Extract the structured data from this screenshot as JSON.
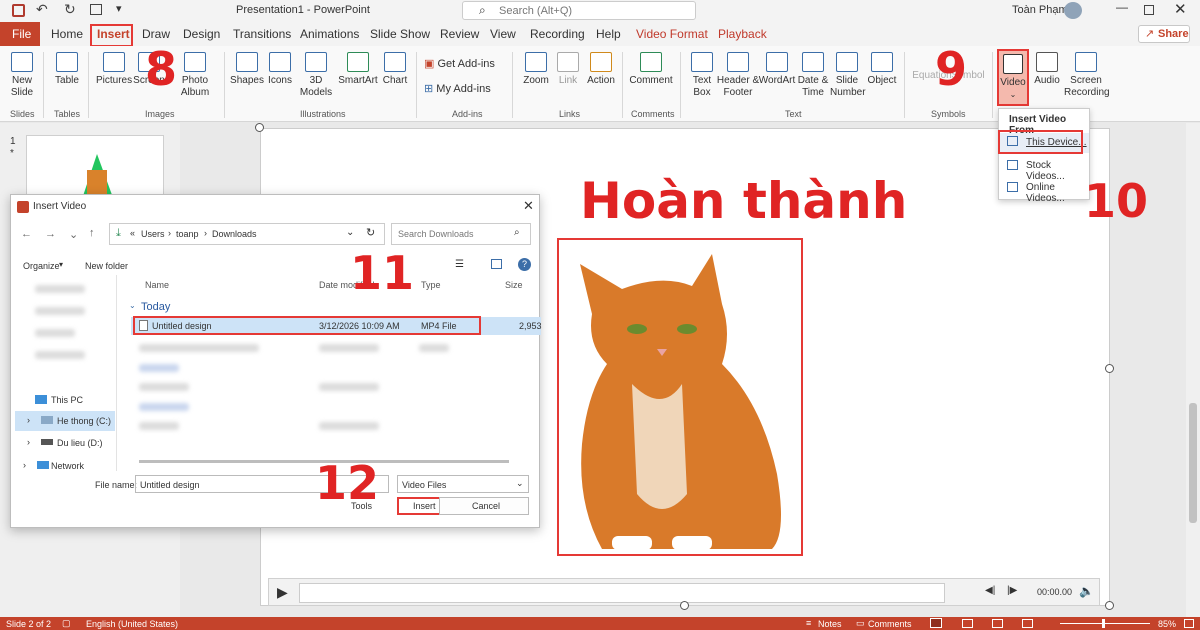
{
  "titlebar": {
    "doc_title": "Presentation1  -  PowerPoint",
    "search_placeholder": "Search (Alt+Q)",
    "user_name": "Toàn Phạm"
  },
  "tabs": {
    "file": "File",
    "home": "Home",
    "insert": "Insert",
    "draw": "Draw",
    "design": "Design",
    "transitions": "Transitions",
    "animations": "Animations",
    "slideshow": "Slide Show",
    "review": "Review",
    "view": "View",
    "recording": "Recording",
    "help": "Help",
    "videoformat": "Video Format",
    "playback": "Playback",
    "share": "Share"
  },
  "ribbon": {
    "new_slide": "New Slide",
    "table": "Table",
    "pictures": "Pictures",
    "screenshot": "Screen",
    "photo_album": "Photo Album",
    "shapes": "Shapes",
    "icons": "Icons",
    "models3d": "3D Models",
    "smartart": "SmartArt",
    "chart": "Chart",
    "get_addins": "Get Add-ins",
    "my_addins": "My Add-ins",
    "zoom": "Zoom",
    "link": "Link",
    "action": "Action",
    "comment": "Comment",
    "textbox": "Text Box",
    "header_footer": "Header & Footer",
    "wordart": "WordArt",
    "datetime": "Date & Time",
    "slide_number": "Slide Number",
    "object": "Object",
    "equation": "Equation",
    "symbol": "Symbol",
    "video": "Video",
    "audio": "Audio",
    "screen_recording": "Screen Recording",
    "groups": {
      "slides": "Slides",
      "tables": "Tables",
      "images": "Images",
      "illustrations": "Illustrations",
      "addins": "Add-ins",
      "links": "Links",
      "comments": "Comments",
      "text": "Text",
      "symbols": "Symbols"
    }
  },
  "video_menu": {
    "header": "Insert Video From",
    "this_device": "This Device...",
    "stock": "Stock Videos...",
    "online": "Online Videos..."
  },
  "thumb": {
    "number": "1",
    "star": "*"
  },
  "steps": {
    "s8": "8",
    "s9": "9",
    "s10": "10",
    "s11": "11",
    "s12": "12"
  },
  "slide": {
    "title": "Hoàn thành"
  },
  "player": {
    "time": "00:00.00"
  },
  "dialog": {
    "title": "Insert Video",
    "path_prefix": "«",
    "path": [
      "Users",
      "toanp",
      "Downloads"
    ],
    "search_placeholder": "Search Downloads",
    "organize": "Organize",
    "new_folder": "New folder",
    "columns": {
      "name": "Name",
      "date": "Date modified",
      "type": "Type",
      "size": "Size"
    },
    "group_today": "Today",
    "file": {
      "name": "Untitled design",
      "date": "3/12/2026 10:09 AM",
      "type": "MP4 File",
      "size": "2,953"
    },
    "nav": {
      "this_pc": "This PC",
      "c_drive": "He thong (C:)",
      "d_drive": "Du lieu (D:)",
      "network": "Network"
    },
    "filename_label": "File name:",
    "filename_value": "Untitled design",
    "filter": "Video Files",
    "tools": "Tools",
    "insert": "Insert",
    "cancel": "Cancel"
  },
  "status": {
    "slide": "Slide 2 of 2",
    "language": "English (United States)",
    "notes": "Notes",
    "comments": "Comments",
    "zoom": "85%"
  },
  "colors": {
    "accent": "#c4432b",
    "red": "#e53935",
    "video_tab": "#c0392b"
  }
}
